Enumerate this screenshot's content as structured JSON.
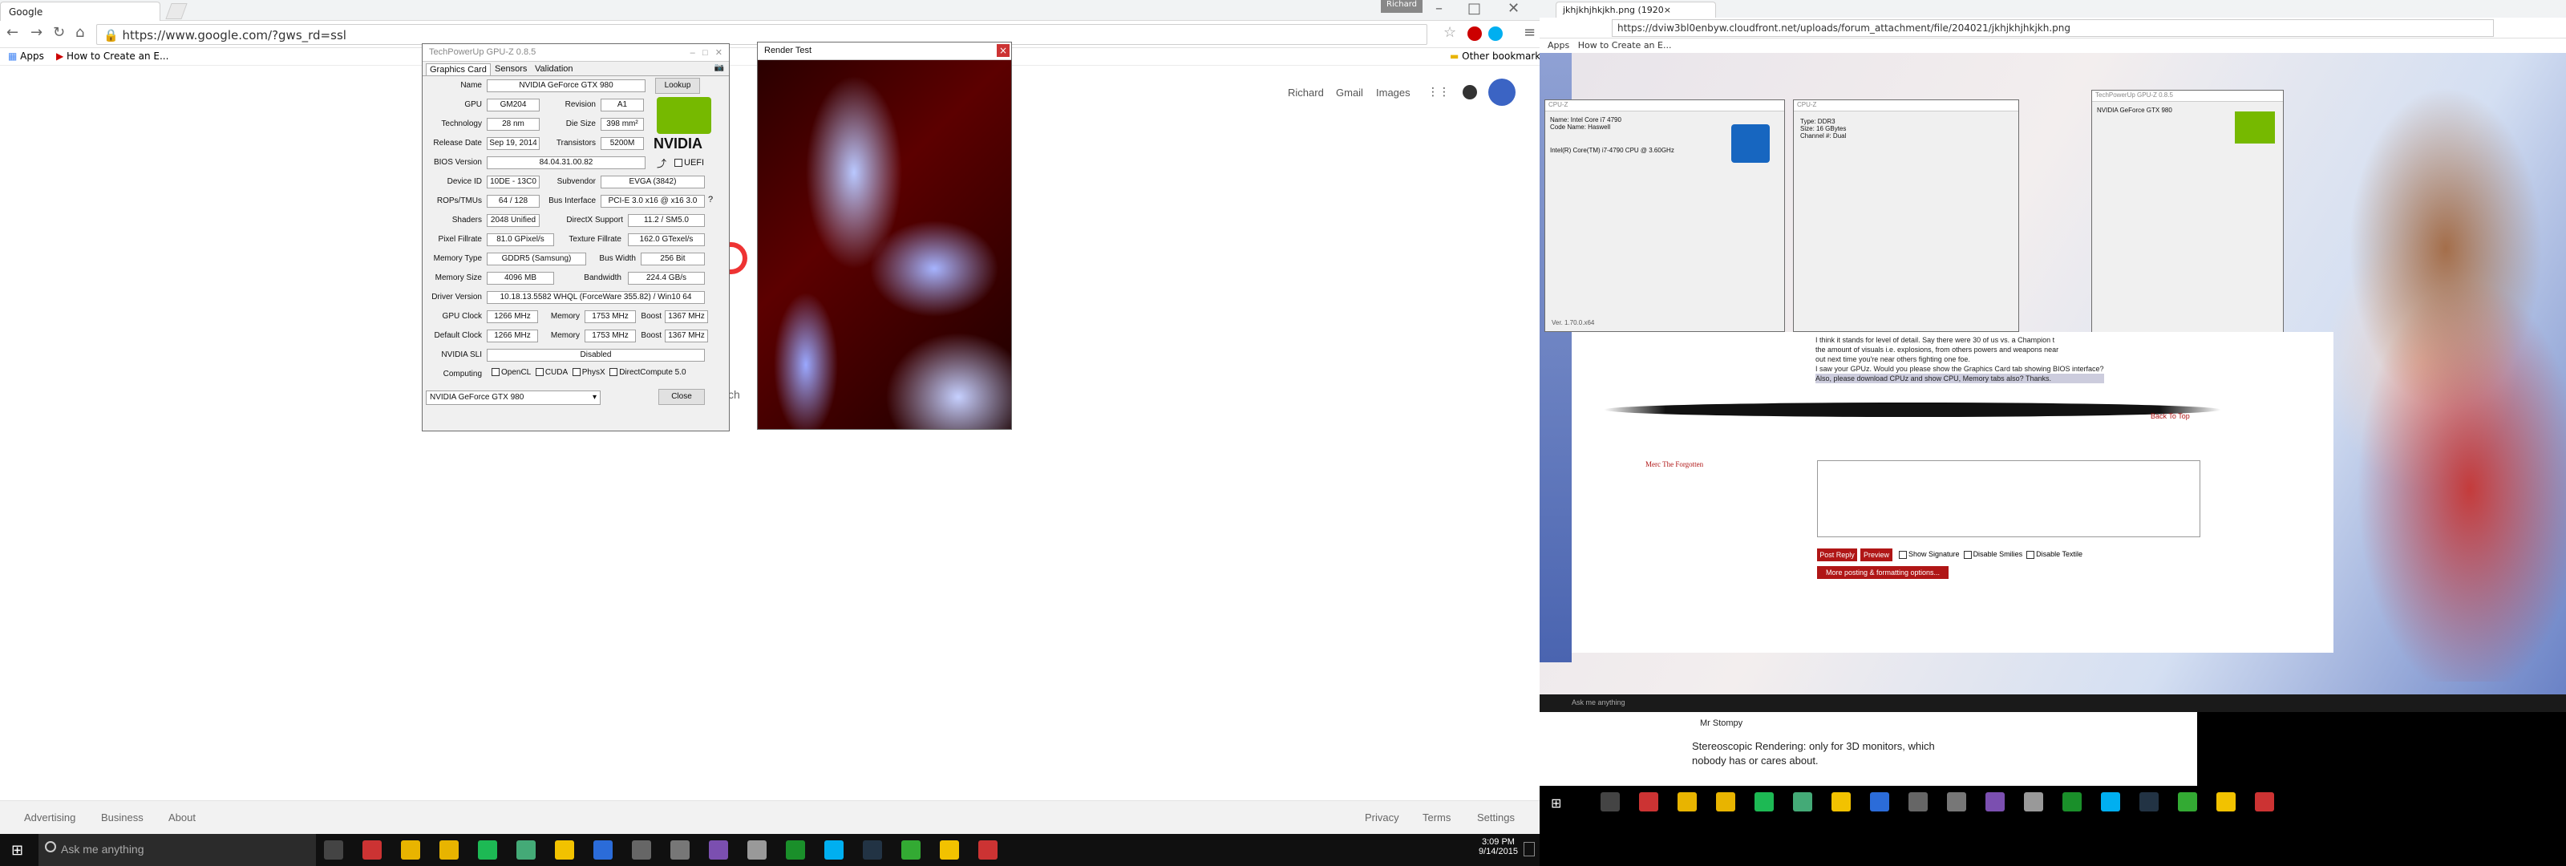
{
  "left_browser": {
    "tab_title": "Google",
    "url": "https://www.google.com/?gws_rd=ssl",
    "bookmarks": [
      "Apps",
      "How to Create an E..."
    ],
    "other_bookmarks": "Other bookmarks",
    "profile": "Richard",
    "top_links": [
      "Richard",
      "Gmail",
      "Images"
    ],
    "search_partial": "ch",
    "footer_left": [
      "Advertising",
      "Business",
      "About"
    ],
    "footer_right": [
      "Privacy",
      "Terms",
      "Settings"
    ]
  },
  "gpuz": {
    "title": "TechPowerUp GPU-Z 0.8.5",
    "tabs": [
      "Graphics Card",
      "Sensors",
      "Validation"
    ],
    "rows": [
      {
        "label": "Name",
        "value": "NVIDIA GeForce GTX 980"
      },
      {
        "label": "GPU",
        "value": "GM204"
      },
      {
        "label": "Technology",
        "value": "28 nm"
      },
      {
        "label": "Release Date",
        "value": "Sep 19, 2014"
      },
      {
        "label": "BIOS Version",
        "value": "84.04.31.00.82"
      },
      {
        "label": "Device ID",
        "value": "10DE - 13C0"
      },
      {
        "label": "ROPs/TMUs",
        "value": "64 / 128"
      },
      {
        "label": "Shaders",
        "value": "2048 Unified"
      },
      {
        "label": "Pixel Fillrate",
        "value": "81.0 GPixel/s"
      },
      {
        "label": "Memory Type",
        "value": "GDDR5 (Samsung)"
      },
      {
        "label": "Memory Size",
        "value": "4096 MB"
      },
      {
        "label": "Driver Version",
        "value": "10.18.13.5582 WHQL (ForceWare 355.82) / Win10 64"
      },
      {
        "label": "GPU Clock",
        "value": "1266 MHz"
      },
      {
        "label": "Default Clock",
        "value": "1266 MHz"
      },
      {
        "label": "NVIDIA SLI",
        "value": "Disabled"
      },
      {
        "label": "Computing",
        "value": ""
      }
    ],
    "right": {
      "revision_label": "Revision",
      "revision": "A1",
      "die_label": "Die Size",
      "die": "398 mm²",
      "trans_label": "Transistors",
      "trans": "5200M",
      "subvendor_label": "Subvendor",
      "subvendor": "EVGA (3842)",
      "bus_label": "Bus Interface",
      "bus": "PCI-E 3.0 x16 @ x16 3.0",
      "dx_label": "DirectX Support",
      "dx": "11.2 / SM5.0",
      "tex_label": "Texture Fillrate",
      "tex": "162.0 GTexel/s",
      "buswidth_label": "Bus Width",
      "buswidth": "256 Bit",
      "bw_label": "Bandwidth",
      "bw": "224.4 GB/s",
      "mem_label": "Memory",
      "mem1": "1753 MHz",
      "mem2": "1753 MHz",
      "boost_label": "Boost",
      "boost1": "1367 MHz",
      "boost2": "1367 MHz",
      "uefi": "UEFI"
    },
    "computing": [
      "OpenCL",
      "CUDA",
      "PhysX",
      "DirectCompute 5.0"
    ],
    "lookup": "Lookup",
    "brand": "NVIDIA",
    "dropdown": "NVIDIA GeForce GTX 980",
    "close": "Close"
  },
  "render_test": {
    "title": "Render Test",
    "close": "×"
  },
  "taskbar": {
    "search": "Ask me anything",
    "time": "3:09 PM",
    "date": "9/14/2015"
  },
  "right_screen": {
    "tab_title": "jkhjkhjhkjkh.png (1920×",
    "url": "https://dviw3bl0enbyw.cloudfront.net/uploads/forum_attachment/file/204021/jkhjkhjhkjkh.png",
    "bookmarks": [
      "Apps",
      "How to Create an E..."
    ],
    "cpuz_title": "CPU-Z",
    "cpuz_processor": "Intel Core i7 4790",
    "cpuz_code": "Haswell",
    "cpuz_spec": "Intel(R) Core(TM) i7-4790 CPU @ 3.60GHz",
    "cpuz_version": "Ver. 1.70.0.x64",
    "mem_type": "DDR3",
    "mem_size": "16 GBytes",
    "mem_channel": "Dual",
    "forum_text1": "I think it stands for level of detail. Say there were 30 of us vs. a Champion t",
    "forum_text2": "the amount of visuals i.e. explosions, from others powers and weapons near",
    "forum_text3": "out next time you're near others fighting one foe.",
    "forum_text4": "I saw your GPUz. Would you please show the Graphics Card tab showing BIOS interface?",
    "forum_text5": "Also, please download CPUz and show CPU, Memory tabs also? Thanks.",
    "back_to_top": "Back To Top",
    "poster": "Merc The Forgotten",
    "post_reply": "Post Reply",
    "preview": "Preview",
    "show_sig": "Show Signature",
    "disable_smilies": "Disable Smilies",
    "disable_textile": "Disable Textile",
    "more_options": "More posting & formatting options...",
    "mr_stompy": "Mr Stompy",
    "stereo1": "Stereoscopic Rendering: only for 3D monitors, which",
    "stereo2": "nobody has or cares about.",
    "inner_search": "Ask me anything"
  },
  "colors": {
    "nvidia_green": "#76b900",
    "taskbar": "#101010",
    "forum_red": "#b01616"
  }
}
